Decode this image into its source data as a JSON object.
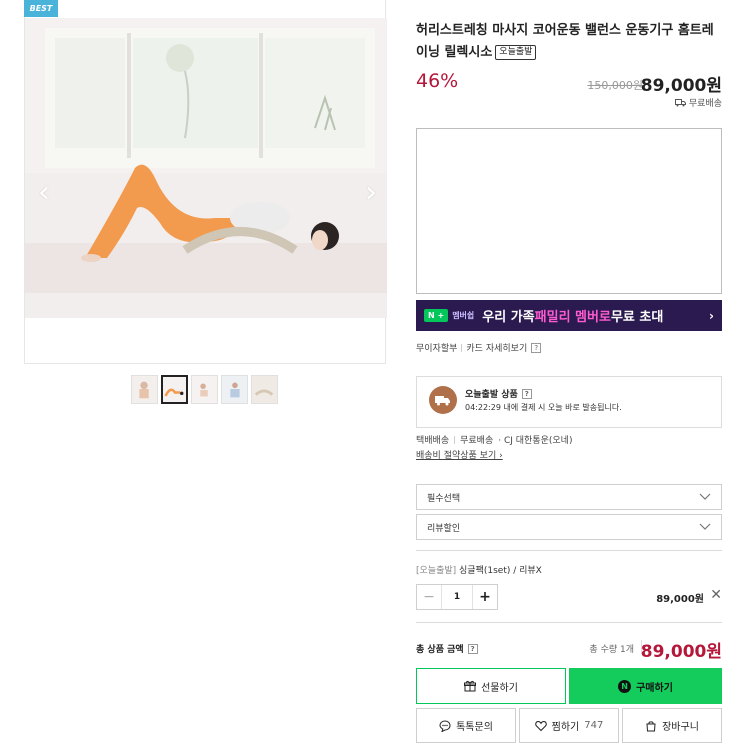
{
  "gallery": {
    "badge": "BEST",
    "prev_icon": "chevron-left-icon",
    "next_icon": "chevron-right-icon",
    "thumbnail_count": 5,
    "active_thumbnail": 2
  },
  "product": {
    "title": "허리스트레칭 마사지 코어운동 밸런스 운동기구 홈트레이닝 릴렉시소",
    "deal_tag": "오늘출발",
    "discount": "46%",
    "original_price": "150,000원",
    "sale_price": "89,000원",
    "shipping_label": "무료배송"
  },
  "banner": {
    "n_badge": "N +",
    "membership": "멤버쉽",
    "text_pre": "우리 가족 ",
    "text_highlight": "패밀리 멤버로",
    "text_post": " 무료 초대",
    "arrow": "›"
  },
  "card": {
    "installment": "무이자할부",
    "card_detail": "카드 자세히보기",
    "help": "?"
  },
  "deal_box": {
    "title": "오늘출발 상품",
    "help": "?",
    "desc": "04:22:29 내에 결제 시 오늘 바로 발송됩니다."
  },
  "delivery": {
    "label": "택배배송",
    "value": "무료배송",
    "carrier": "· CJ 대한통운(오네)",
    "policy_link": "배송비 절약상품 보기 ›"
  },
  "selects": {
    "required": "필수선택",
    "review": "리뷰할인"
  },
  "option": {
    "tag": "[오늘출발]",
    "name": " 싱글팩(1set) / 리뷰X",
    "qty_minus": "−",
    "qty": "1",
    "qty_plus": "+",
    "price": "89,000원",
    "remove": "✕"
  },
  "total": {
    "label": "총 상품 금액",
    "help": "?",
    "count": "총 수량 1개",
    "price": "89,000원"
  },
  "buttons": {
    "gift": "선물하기",
    "buy_icon": "N",
    "buy": "구매하기",
    "talk": "톡톡문의",
    "wish": "찜하기",
    "wish_count": "747",
    "cart": "장바구니"
  },
  "colors": {
    "accent_green": "#14cc5c",
    "price_red": "#b5173a",
    "badge_blue": "#4ab3d9",
    "banner_purple": "#2a1a4f"
  }
}
